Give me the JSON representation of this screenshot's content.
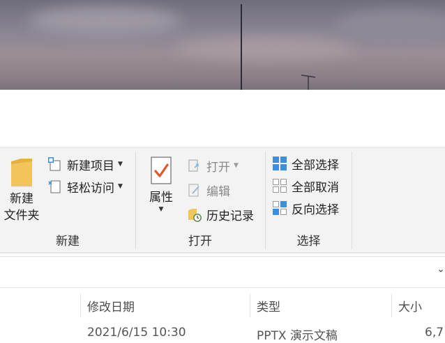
{
  "ribbon": {
    "new_group": {
      "label": "新建",
      "new_folder": "新建\n文件夹",
      "new_item": "新建项目",
      "easy_access": "轻松访问"
    },
    "open_group": {
      "label": "打开",
      "properties": "属性",
      "open": "打开",
      "edit": "编辑",
      "history": "历史记录"
    },
    "select_group": {
      "label": "选择",
      "select_all": "全部选择",
      "select_none": "全部取消",
      "invert_selection": "反向选择"
    }
  },
  "file_list": {
    "columns": [
      "修改日期",
      "类型",
      "大小"
    ],
    "rows": [
      {
        "date": "2021/6/15 10:30",
        "type": "PPTX 演示文稿",
        "size": "6,7"
      }
    ]
  },
  "colors": {
    "accent_blue": "#3c8fdc",
    "check_orange": "#e0562b",
    "folder_yellow": "#f2c55c"
  },
  "icons": {
    "new_folder": "folder-icon",
    "new_item": "new-item-icon",
    "easy_access": "easy-access-icon",
    "properties": "properties-check-icon",
    "open": "open-icon",
    "edit": "edit-icon",
    "history": "history-icon",
    "select_all": "select-all-icon",
    "select_none": "select-none-icon",
    "invert": "invert-selection-icon",
    "address_dropdown": "chevron-down-icon"
  }
}
